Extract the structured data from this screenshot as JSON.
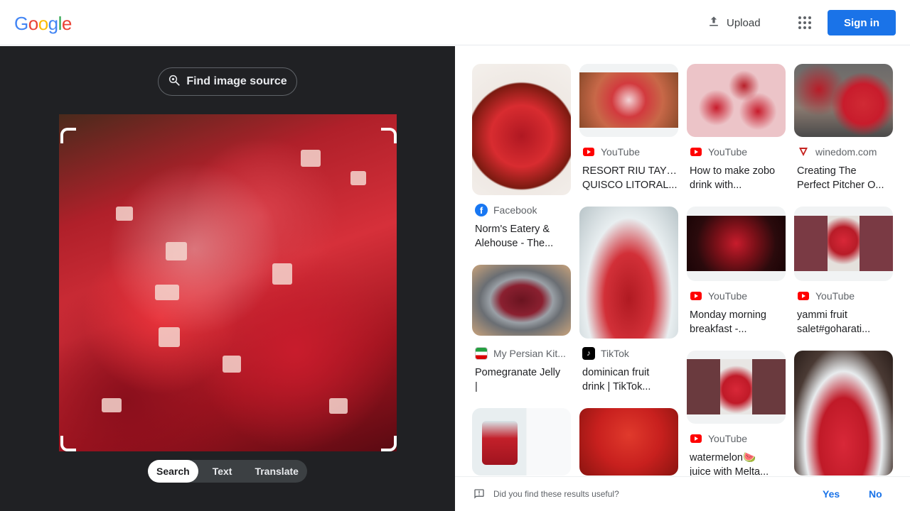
{
  "header": {
    "logo_letters": [
      "G",
      "o",
      "o",
      "g",
      "l",
      "e"
    ],
    "logo_colors": [
      "#4285f4",
      "#ea4335",
      "#fbbc05",
      "#4285f4",
      "#34a853",
      "#ea4335"
    ],
    "upload_label": "Upload",
    "signin_label": "Sign in"
  },
  "lens": {
    "find_source_label": "Find image source",
    "tabs": [
      {
        "label": "Search",
        "active": true
      },
      {
        "label": "Text",
        "active": false
      },
      {
        "label": "Translate",
        "active": false
      }
    ]
  },
  "results": [
    {
      "source": "",
      "source_icon": "",
      "title1": "",
      "title2": ""
    },
    {
      "source": "YouTube",
      "source_icon": "youtube-icon",
      "title1": "RESORT RIU TAY EL",
      "title2": "QUISCO LITORAL..."
    },
    {
      "source": "YouTube",
      "source_icon": "youtube-icon",
      "title1": "How to make zobo",
      "title2": "drink with..."
    },
    {
      "source": "winedom.com",
      "source_icon": "winedom-icon",
      "title1": "Creating The",
      "title2": "Perfect Pitcher O..."
    },
    {
      "source": "Facebook",
      "source_icon": "facebook-icon",
      "title1": "Norm's Eatery &",
      "title2": "Alehouse - The..."
    },
    {
      "source": "YouTube",
      "source_icon": "youtube-icon",
      "title1": "Monday morning",
      "title2": "breakfast -..."
    },
    {
      "source": "YouTube",
      "source_icon": "youtube-icon",
      "title1": "yammi fruit",
      "title2": "salet#goharati..."
    },
    {
      "source": "My Persian Kit...",
      "source_icon": "mypersian-icon",
      "title1": "Pomegranate Jelly",
      "title2": "|"
    },
    {
      "source": "TikTok",
      "source_icon": "tiktok-icon",
      "title1": "dominican fruit",
      "title2": "drink | TikTok..."
    },
    {
      "source": "YouTube",
      "source_icon": "youtube-icon",
      "title1": "watermelon🍉",
      "title2": "juice with Melta..."
    }
  ],
  "feedback": {
    "question": "Did you find these results useful?",
    "yes": "Yes",
    "no": "No"
  }
}
